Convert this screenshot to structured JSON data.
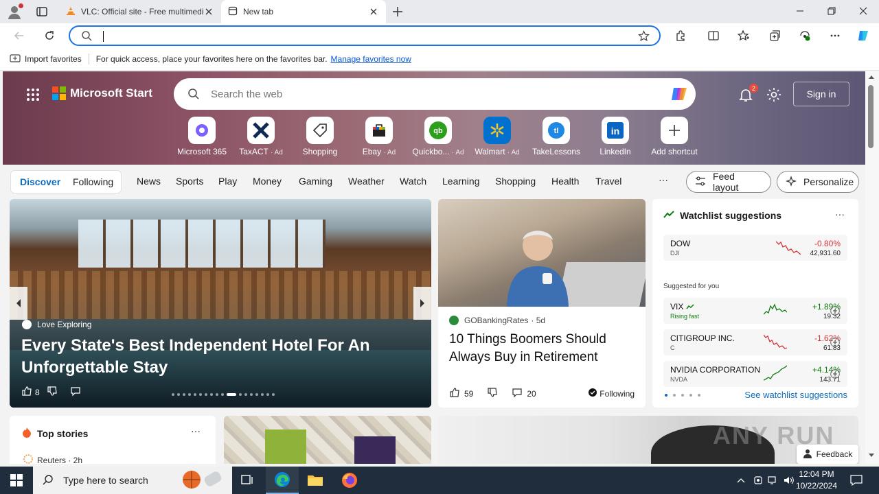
{
  "browser": {
    "tabs": [
      {
        "title": "VLC: Official site - Free multimedia solutions for all OS!",
        "icon": "vlc-cone-icon"
      },
      {
        "title": "New tab",
        "icon": "newtab-icon"
      }
    ],
    "address_value": "",
    "favorites_bar": {
      "import_label": "Import favorites",
      "message": "For quick access, place your favorites here on the favorites bar.",
      "manage_link": "Manage favorites now"
    }
  },
  "header": {
    "brand": "Microsoft Start",
    "search_placeholder": "Search the web",
    "notification_count": "2",
    "sign_in": "Sign in"
  },
  "shortcuts": [
    {
      "label": "Microsoft 365",
      "ad": ""
    },
    {
      "label": "TaxACT",
      "ad": "· Ad"
    },
    {
      "label": "Shopping",
      "ad": ""
    },
    {
      "label": "Ebay",
      "ad": "· Ad"
    },
    {
      "label": "Quickbo...",
      "ad": "· Ad"
    },
    {
      "label": "Walmart",
      "ad": "· Ad"
    },
    {
      "label": "TakeLessons",
      "ad": ""
    },
    {
      "label": "LinkedIn",
      "ad": ""
    },
    {
      "label": "Add shortcut",
      "ad": ""
    }
  ],
  "nav": {
    "discover": "Discover",
    "following": "Following",
    "categories": [
      "News",
      "Sports",
      "Play",
      "Money",
      "Gaming",
      "Weather",
      "Watch",
      "Learning",
      "Shopping",
      "Health",
      "Travel"
    ],
    "more": "···",
    "feed_layout": "Feed layout",
    "personalize": "Personalize"
  },
  "featured": {
    "source": "Love Exploring",
    "headline": "Every State's Best Independent Hotel For An Unforgettable Stay",
    "likes": "8"
  },
  "story": {
    "source": "GOBankingRates",
    "age": "· 5d",
    "headline": "10 Things Boomers Should Always Buy in Retirement",
    "likes": "59",
    "comments": "20",
    "following": "Following"
  },
  "watchlist": {
    "title": "Watchlist suggestions",
    "more": "···",
    "suggested_label": "Suggested for you",
    "see_all": "See watchlist suggestions",
    "stocks": [
      {
        "name": "DOW",
        "symbol": "DJI",
        "change": "-0.80%",
        "price": "42,931.60",
        "trend": "down",
        "color": "#d13438"
      },
      {
        "name": "VIX",
        "symbol": "Rising fast",
        "change": "+1.89%",
        "price": "19.32",
        "trend": "up",
        "color": "#107c10"
      },
      {
        "name": "CITIGROUP INC.",
        "symbol": "C",
        "change": "-1.62%",
        "price": "61.83",
        "trend": "down",
        "color": "#d13438"
      },
      {
        "name": "NVIDIA CORPORATION",
        "symbol": "NVDA",
        "change": "+4.14%",
        "price": "143.71",
        "trend": "up",
        "color": "#107c10"
      }
    ]
  },
  "top_stories": {
    "title": "Top stories",
    "more": "···",
    "first_source": "Reuters · 2h"
  },
  "watermark": "ANY RUN",
  "feedback": "Feedback",
  "taskbar": {
    "search_placeholder": "Type here to search",
    "time": "12:04 PM",
    "date": "10/22/2024"
  }
}
